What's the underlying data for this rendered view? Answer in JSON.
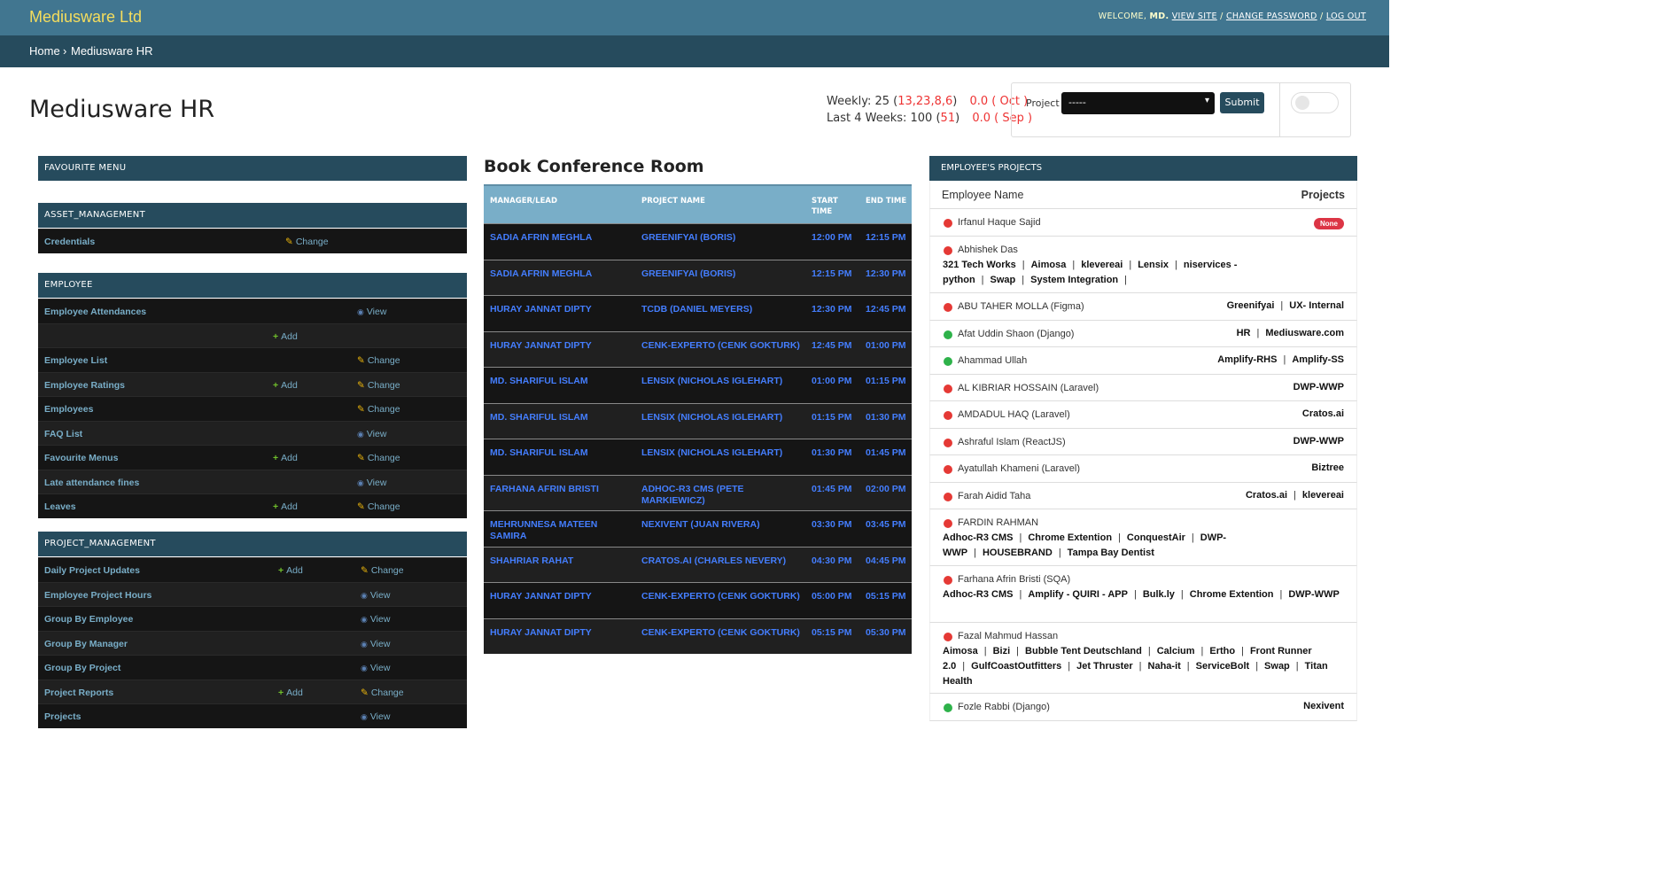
{
  "header": {
    "brand": "Mediusware Ltd",
    "welcome": "WELCOME,",
    "user": "MD.",
    "view_site": "VIEW SITE",
    "change_password": "CHANGE PASSWORD",
    "log_out": "LOG OUT",
    "sep": "/"
  },
  "breadcrumb": {
    "home": "Home",
    "sep": "›",
    "current": "Mediusware HR"
  },
  "page_title": "Mediusware HR",
  "stats": {
    "weekly_label": "Weekly: 25 (",
    "weekly_detail": "13,23,8,6",
    "weekly_close": ")",
    "weekly_extra": "0.0 ( Oct )",
    "last4_label": "Last 4 Weeks: 100 (",
    "last4_detail": "51",
    "last4_close": ")",
    "last4_extra": "0.0 ( Sep )"
  },
  "project_filter": {
    "label": "Project",
    "selected": "-----",
    "submit": "Submit"
  },
  "favourite": {
    "title": "FAVOURITE MENU"
  },
  "asset": {
    "title": "ASSET_MANAGEMENT",
    "rows": [
      {
        "name": "Credentials",
        "change": "Change"
      }
    ]
  },
  "employee": {
    "title": "EMPLOYEE",
    "rows": [
      {
        "name": "Employee Attendances",
        "view": "View"
      },
      {
        "name": "",
        "add": "Add"
      },
      {
        "name": "Employee List",
        "change": "Change"
      },
      {
        "name": "Employee Ratings",
        "add": "Add",
        "change": "Change"
      },
      {
        "name": "Employees",
        "change": "Change"
      },
      {
        "name": "FAQ List",
        "view": "View"
      },
      {
        "name": "Favourite Menus",
        "add": "Add",
        "change": "Change"
      },
      {
        "name": "Late attendance fines",
        "view": "View"
      },
      {
        "name": "Leaves",
        "add": "Add",
        "change": "Change"
      }
    ]
  },
  "project_mgmt": {
    "title": "PROJECT_MANAGEMENT",
    "rows": [
      {
        "name": "Daily Project Updates",
        "add": "Add",
        "change": "Change"
      },
      {
        "name": "Employee Project Hours",
        "view": "View"
      },
      {
        "name": "Group By Employee",
        "view": "View"
      },
      {
        "name": "Group By Manager",
        "view": "View"
      },
      {
        "name": "Group By Project",
        "view": "View"
      },
      {
        "name": "Project Reports",
        "add": "Add",
        "change": "Change"
      },
      {
        "name": "Projects",
        "view": "View"
      }
    ]
  },
  "conference": {
    "title": "Book Conference Room",
    "headers": {
      "manager": "MANAGER/LEAD",
      "project": "PROJECT NAME",
      "start": "START TIME",
      "end": "END TIME"
    },
    "rows": [
      {
        "manager": "SADIA AFRIN MEGHLA",
        "project": "GREENIFYAI (BORIS)",
        "start": "12:00 PM",
        "end": "12:15 PM"
      },
      {
        "manager": "SADIA AFRIN MEGHLA",
        "project": "GREENIFYAI (BORIS)",
        "start": "12:15 PM",
        "end": "12:30 PM"
      },
      {
        "manager": "HURAY JANNAT DIPTY",
        "project": "TCDB (DANIEL MEYERS)",
        "start": "12:30 PM",
        "end": "12:45 PM"
      },
      {
        "manager": "HURAY JANNAT DIPTY",
        "project": "CENK-EXPERTO (CENK GOKTURK)",
        "start": "12:45 PM",
        "end": "01:00 PM"
      },
      {
        "manager": "MD. SHARIFUL ISLAM",
        "project": "LENSIX (NICHOLAS IGLEHART)",
        "start": "01:00 PM",
        "end": "01:15 PM"
      },
      {
        "manager": "MD. SHARIFUL ISLAM",
        "project": "LENSIX (NICHOLAS IGLEHART)",
        "start": "01:15 PM",
        "end": "01:30 PM"
      },
      {
        "manager": "MD. SHARIFUL ISLAM",
        "project": "LENSIX (NICHOLAS IGLEHART)",
        "start": "01:30 PM",
        "end": "01:45 PM"
      },
      {
        "manager": "FARHANA AFRIN BRISTI",
        "project": "ADHOC-R3 CMS (PETE MARKIEWICZ)",
        "start": "01:45 PM",
        "end": "02:00 PM"
      },
      {
        "manager": "MEHRUNNESA MATEEN SAMIRA",
        "project": "NEXIVENT (JUAN RIVERA)",
        "start": "03:30 PM",
        "end": "03:45 PM"
      },
      {
        "manager": "SHAHRIAR RAHAT",
        "project": "CRATOS.AI (CHARLES NEVERY)",
        "start": "04:30 PM",
        "end": "04:45 PM"
      },
      {
        "manager": "HURAY JANNAT DIPTY",
        "project": "CENK-EXPERTO (CENK GOKTURK)",
        "start": "05:00 PM",
        "end": "05:15 PM"
      },
      {
        "manager": "HURAY JANNAT DIPTY",
        "project": "CENK-EXPERTO (CENK GOKTURK)",
        "start": "05:15 PM",
        "end": "05:30 PM"
      }
    ]
  },
  "employee_projects": {
    "title": "EMPLOYEE'S PROJECTS",
    "col_name": "Employee Name",
    "col_projects": "Projects",
    "none_badge": "None",
    "rows": [
      {
        "name": "Irfanul Haque Sajid",
        "status": "red",
        "projects": [],
        "none": true
      },
      {
        "name": "Abhishek Das",
        "status": "red",
        "projects": [
          "321 Tech Works",
          "Aimosa",
          "klevereai",
          "Lensix",
          "niservices - python",
          "Swap",
          "System Integration"
        ],
        "block": true
      },
      {
        "name": "ABU TAHER MOLLA (Figma)",
        "status": "red",
        "projects": [
          "Greenifyai",
          "UX- Internal"
        ]
      },
      {
        "name": "Afat Uddin Shaon (Django)",
        "status": "green",
        "projects": [
          "HR",
          "Mediusware.com"
        ]
      },
      {
        "name": "Ahammad Ullah",
        "status": "green",
        "projects": [
          "Amplify-RHS",
          "Amplify-SS"
        ]
      },
      {
        "name": "AL KIBRIAR HOSSAIN (Laravel)",
        "status": "red",
        "projects": [
          "DWP-WWP"
        ]
      },
      {
        "name": "AMDADUL HAQ (Laravel)",
        "status": "red",
        "projects": [
          "Cratos.ai"
        ]
      },
      {
        "name": "Ashraful Islam (ReactJS)",
        "status": "red",
        "projects": [
          "DWP-WWP"
        ]
      },
      {
        "name": "Ayatullah Khameni (Laravel)",
        "status": "red",
        "projects": [
          "Biztree"
        ]
      },
      {
        "name": "Farah Aidid Taha",
        "status": "red",
        "projects": [
          "Cratos.ai",
          "klevereai"
        ]
      },
      {
        "name": "FARDIN RAHMAN",
        "status": "red",
        "projects": [
          "Adhoc-R3 CMS",
          "Chrome Extention",
          "ConquestAir",
          "DWP-WWP",
          "HOUSEBRAND",
          "Tampa Bay Dentist"
        ],
        "block": true
      },
      {
        "name": "Farhana Afrin Bristi (SQA)",
        "status": "red",
        "projects": [
          "Adhoc-R3 CMS",
          "Amplify - QUIRI - APP",
          "Bulk.ly",
          "Chrome Extention",
          "DWP-WWP"
        ],
        "block": true
      },
      {
        "name": "Fazal Mahmud Hassan",
        "status": "red",
        "projects": [
          "Aimosa",
          "Bizi",
          "Bubble Tent Deutschland",
          "Calcium",
          "Ertho",
          "Front Runner 2.0",
          "GulfCoastOutfitters",
          "Jet Thruster",
          "Naha-it",
          "ServiceBolt",
          "Swap",
          "Titan Health"
        ],
        "block": true
      },
      {
        "name": "Fozle Rabbi (Django)",
        "status": "green",
        "projects": [
          "Nexivent"
        ]
      }
    ]
  },
  "colors": {
    "header": "#417690",
    "breadcrumb": "#264b5d",
    "brand": "#f5dd5d",
    "link": "#79aec8",
    "conf_link": "#447eff",
    "red": "#e53935",
    "green": "#2eb24a"
  }
}
